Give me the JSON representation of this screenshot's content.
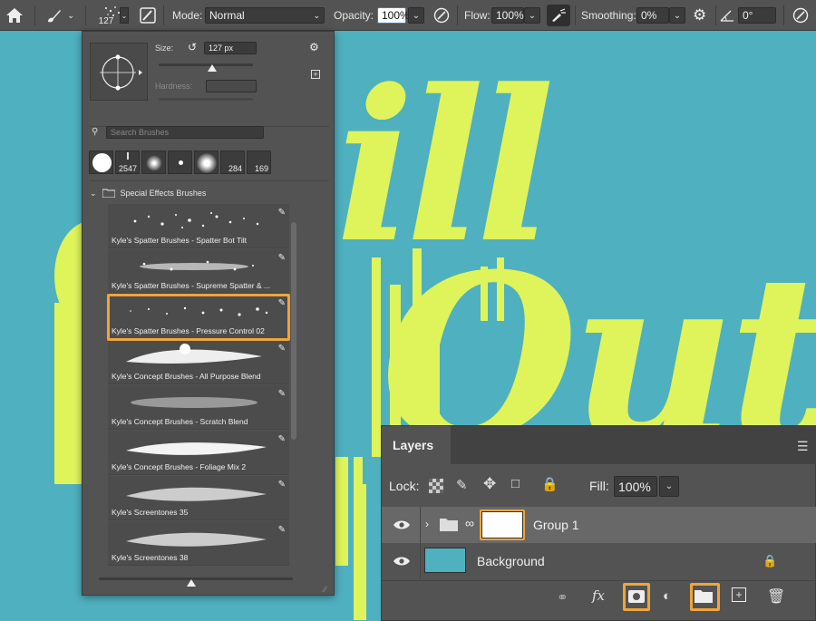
{
  "toolbar": {
    "brush_size": "127",
    "mode_label": "Mode:",
    "mode_value": "Normal",
    "opacity_label": "Opacity:",
    "opacity_value": "100%",
    "flow_label": "Flow:",
    "flow_value": "100%",
    "smoothing_label": "Smoothing:",
    "smoothing_value": "0%",
    "angle_value": "0°"
  },
  "brush_panel": {
    "size_label": "Size:",
    "size_value": "127 px",
    "hardness_label": "Hardness:",
    "search_placeholder": "Search Brushes",
    "presets": [
      {
        "num": ""
      },
      {
        "num": "2547"
      },
      {
        "num": ""
      },
      {
        "num": ""
      },
      {
        "num": ""
      },
      {
        "num": "284"
      },
      {
        "num": "169"
      }
    ],
    "folder_label": "Special Effects Brushes",
    "brushes": [
      {
        "name": "Kyle's Spatter Brushes - Spatter Bot Tilt"
      },
      {
        "name": "Kyle's Spatter Brushes - Supreme Spatter & ..."
      },
      {
        "name": "Kyle's Spatter Brushes - Pressure Control 02"
      },
      {
        "name": "Kyle's Concept Brushes - All Purpose Blend"
      },
      {
        "name": "Kyle's Concept Brushes - Scratch Blend"
      },
      {
        "name": "Kyle's Concept Brushes - Foliage Mix 2"
      },
      {
        "name": "Kyle's Screentones 35"
      },
      {
        "name": "Kyle's Screentones 38"
      }
    ]
  },
  "layers_panel": {
    "title": "Layers",
    "lock_label": "Lock:",
    "fill_label": "Fill:",
    "fill_value": "100%",
    "layers": [
      {
        "name": "Group 1"
      },
      {
        "name": "Background"
      }
    ]
  },
  "canvas": {
    "art_letters": [
      "ill",
      "Out"
    ]
  },
  "colors": {
    "canvas_bg": "#4fb0bf",
    "art": "#dff35a",
    "highlight": "#f0a53a",
    "panel": "#535353"
  }
}
